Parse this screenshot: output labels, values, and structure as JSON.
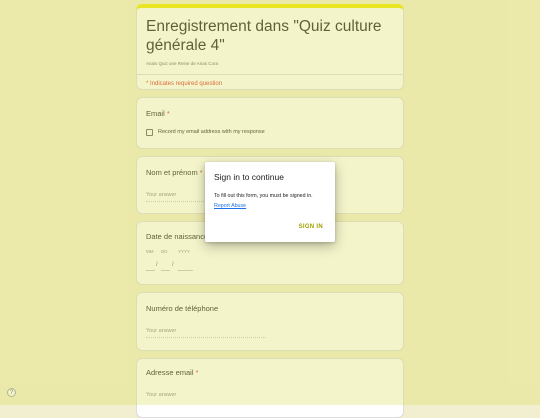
{
  "form": {
    "title": "Enregistrement dans \"Quiz culture générale 4\"",
    "subtitle": "Anais Quiz une Reine de Anas Cora",
    "required_note": "* Indicates required question"
  },
  "questions": {
    "email": {
      "label": "Email",
      "required_mark": "*",
      "checkbox_label": "Record my email address with my response"
    },
    "nom": {
      "label": "Nom et prénom",
      "required_mark": "*",
      "placeholder": "Your answer"
    },
    "date": {
      "label": "Date de naissance",
      "mm": "MM",
      "dd": "DD",
      "yyyy": "YYYY",
      "sep": "/"
    },
    "phone": {
      "label": "Numéro de téléphone",
      "placeholder": "Your answer"
    },
    "adresse": {
      "label": "Adresse email",
      "required_mark": "*",
      "placeholder": "Your answer"
    }
  },
  "dialog": {
    "title": "Sign in to continue",
    "body": "To fill out this form, you must be signed in.",
    "link": "Report Abuse",
    "button": "SIGN IN"
  },
  "help": {
    "icon": "help-icon",
    "glyph": "?"
  },
  "colors": {
    "accent": "#ede900",
    "background": "#f1efcf",
    "required": "#d93025",
    "link": "#1a73e8"
  }
}
